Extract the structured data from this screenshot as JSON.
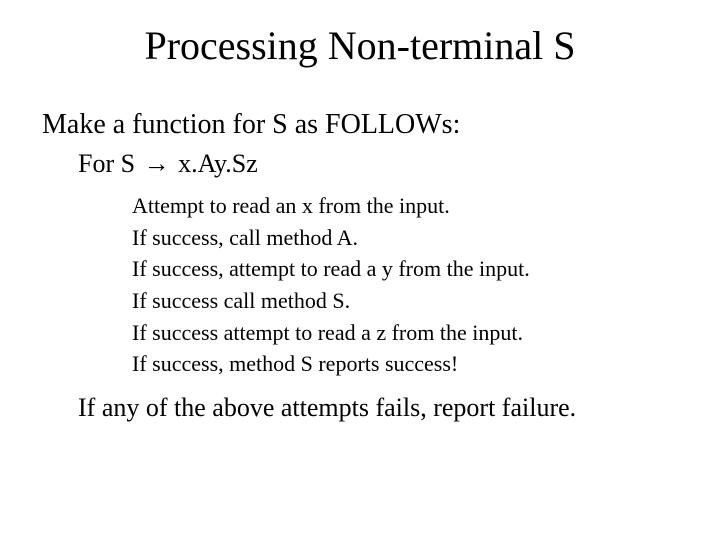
{
  "title": "Processing Non-terminal S",
  "intro": "Make a function for S as FOLLOWs:",
  "rule_prefix": "For S ",
  "rule_arrow": "→",
  "rule_rhs": " x.Ay.Sz",
  "steps": [
    "Attempt to read an x from the input.",
    "If success, call method A.",
    "If success, attempt to read a y from the input.",
    "If success call method S.",
    "If success attempt to read a z from the input.",
    "If success, method S reports success!"
  ],
  "closing": "If any of the above attempts fails, report failure."
}
